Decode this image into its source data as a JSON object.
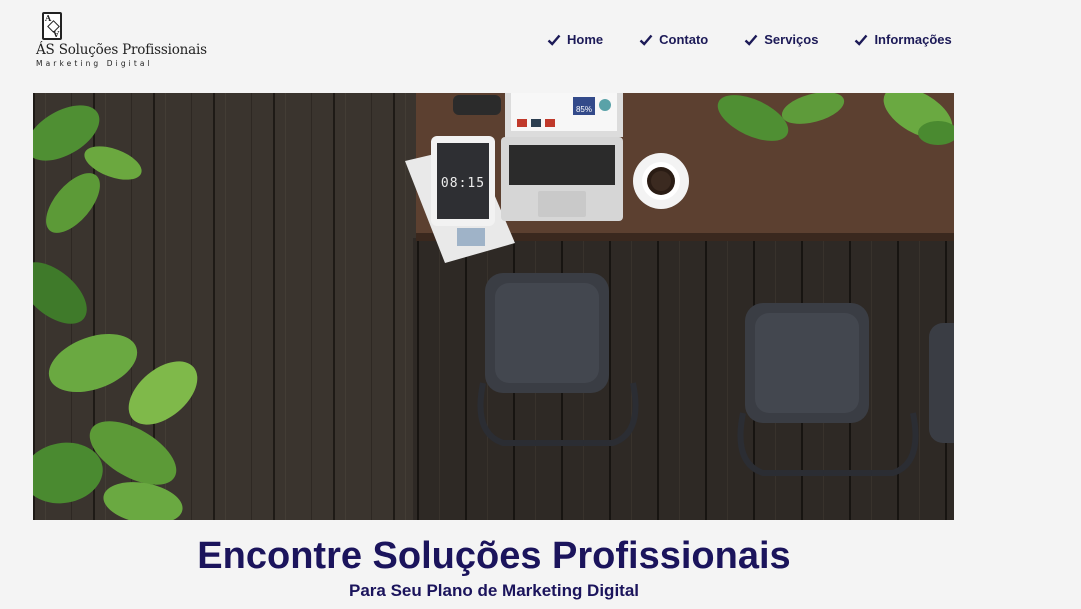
{
  "brand": {
    "title": "ÁS Soluções Profissionais",
    "tagline": "Marketing Digital",
    "logo_icon": "ace-of-diamonds-card-icon"
  },
  "nav": {
    "items": [
      {
        "label": "Home",
        "icon": "check-icon"
      },
      {
        "label": "Contato",
        "icon": "check-icon"
      },
      {
        "label": "Serviços",
        "icon": "check-icon"
      },
      {
        "label": "Informações",
        "icon": "check-icon"
      }
    ]
  },
  "hero": {
    "image_description": "top-down view of wooden deck with desk, laptop, tablet, coffee cup, chairs and plants",
    "tablet_clock": "08:15",
    "laptop_badge": "85%"
  },
  "headline": "Encontre Soluções Profissionais",
  "subheadline": "Para Seu Plano de Marketing Digital",
  "colors": {
    "background": "#f4f4f4",
    "accent_navy": "#1b145c"
  }
}
